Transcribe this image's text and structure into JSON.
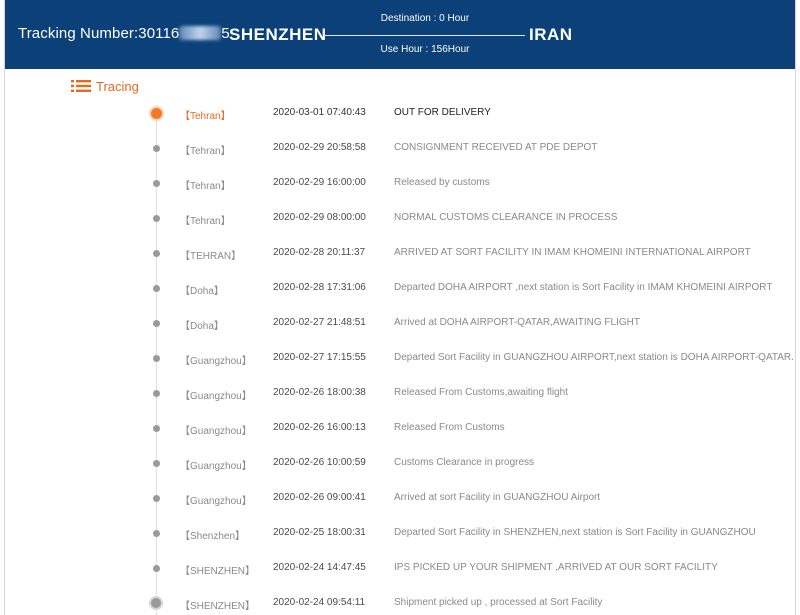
{
  "header": {
    "tracking_label": "Tracking Number:",
    "tracking_number_visible": "30116",
    "tracking_number_suffix": "5",
    "origin": "SHENZHEN",
    "destination": "IRAN",
    "destination_hours": "Destination : 0 Hour",
    "use_hours": "Use Hour : 156Hour"
  },
  "section": {
    "title": "Tracing",
    "icon": "list-icon"
  },
  "colors": {
    "header_bg": "#0b4178",
    "accent": "#e66a1c",
    "muted_text": "#8a8a8a"
  },
  "events": [
    {
      "location": "【Tehran】",
      "time": "2020-03-01 07:40:43",
      "description": "OUT FOR DELIVERY"
    },
    {
      "location": "【Tehran】",
      "time": "2020-02-29 20:58:58",
      "description": "CONSIGNMENT RECEIVED AT PDE DEPOT"
    },
    {
      "location": "【Tehran】",
      "time": "2020-02-29 16:00:00",
      "description": "Released by customs"
    },
    {
      "location": "【Tehran】",
      "time": "2020-02-29 08:00:00",
      "description": "NORMAL CUSTOMS CLEARANCE IN PROCESS"
    },
    {
      "location": "【TEHRAN】",
      "time": "2020-02-28 20:11:37",
      "description": "ARRIVED AT SORT FACILITY IN IMAM KHOMEINI INTERNATIONAL AIRPORT"
    },
    {
      "location": "【Doha】",
      "time": "2020-02-28 17:31:06",
      "description": "Departed DOHA AIRPORT ,next station is Sort Facility in IMAM KHOMEINI AIRPORT"
    },
    {
      "location": "【Doha】",
      "time": "2020-02-27 21:48:51",
      "description": "Arrived at DOHA AIRPORT-QATAR,AWAITING FLIGHT"
    },
    {
      "location": "【Guangzhou】",
      "time": "2020-02-27 17:15:55",
      "description": "Departed Sort Facility in GUANGZHOU AIRPORT,next station is DOHA AIRPORT-QATAR."
    },
    {
      "location": "【Guangzhou】",
      "time": "2020-02-26 18:00:38",
      "description": "Released From Customs,awaiting flight"
    },
    {
      "location": "【Guangzhou】",
      "time": "2020-02-26 16:00:13",
      "description": "Released From Customs"
    },
    {
      "location": "【Guangzhou】",
      "time": "2020-02-26 10:00:59",
      "description": "Customs Clearance in progress"
    },
    {
      "location": "【Guangzhou】",
      "time": "2020-02-26 09:00:41",
      "description": "Arrived at sort Facility in GUANGZHOU Airport"
    },
    {
      "location": "【Shenzhen】",
      "time": "2020-02-25 18:00:31",
      "description": "Departed Sort Facility in SHENZHEN,next station is Sort Facility in GUANGZHOU"
    },
    {
      "location": "【SHENZHEN】",
      "time": "2020-02-24 14:47:45",
      "description": "IPS PICKED UP YOUR SHIPMENT ,ARRIVED AT OUR SORT FACILITY"
    },
    {
      "location": "【SHENZHEN】",
      "time": "2020-02-24 09:54:11",
      "description": "Shipment picked up , processed at Sort Facility"
    }
  ]
}
